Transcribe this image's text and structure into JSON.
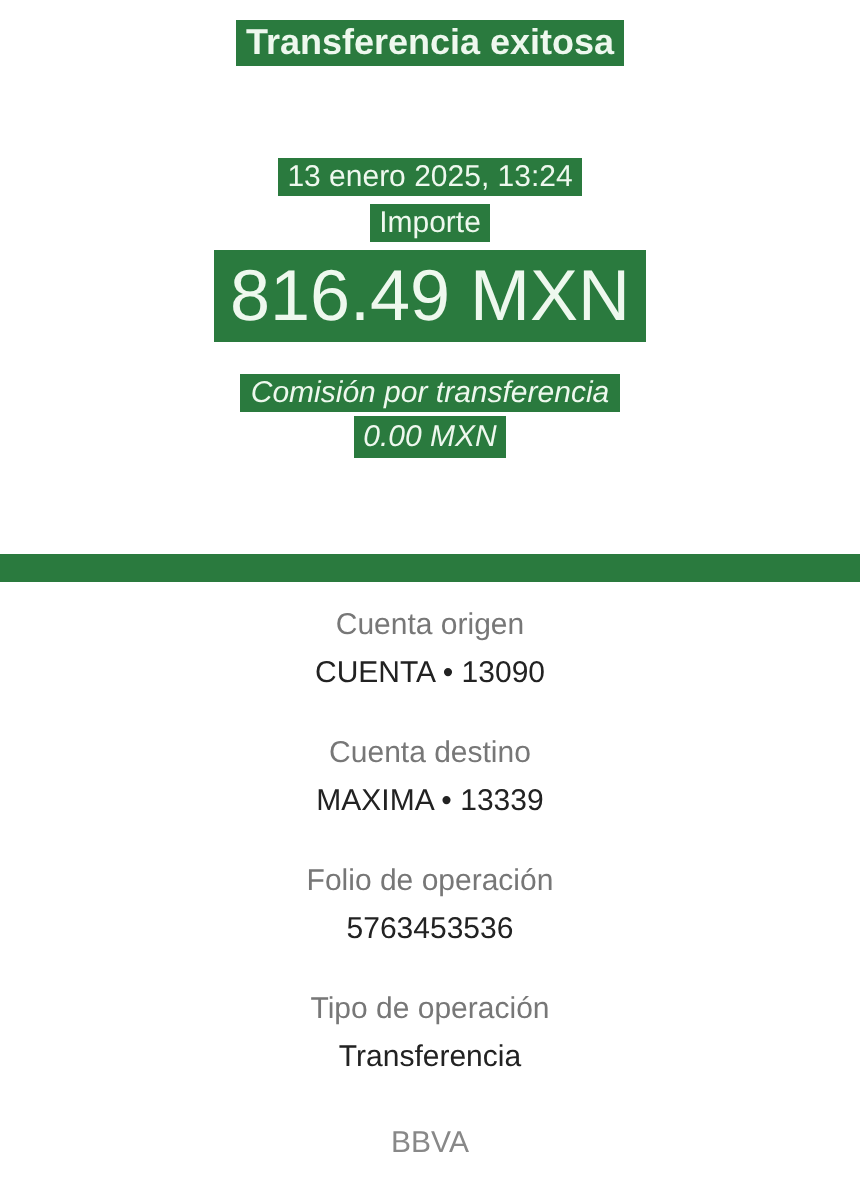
{
  "title": "Transferencia exitosa",
  "date": "13 enero 2025, 13:24",
  "amount_label": "Importe",
  "amount": "816.49 MXN",
  "fee_label": "Comisión por transferencia",
  "fee": "0.00 MXN",
  "details": [
    {
      "label": "Cuenta origen",
      "value": "CUENTA • 13090"
    },
    {
      "label": "Cuenta destino",
      "value": "MAXIMA • 13339"
    },
    {
      "label": "Folio de operación",
      "value": "5763453536"
    },
    {
      "label": "Tipo de operación",
      "value": "Transferencia"
    }
  ],
  "footer": "BBVA"
}
